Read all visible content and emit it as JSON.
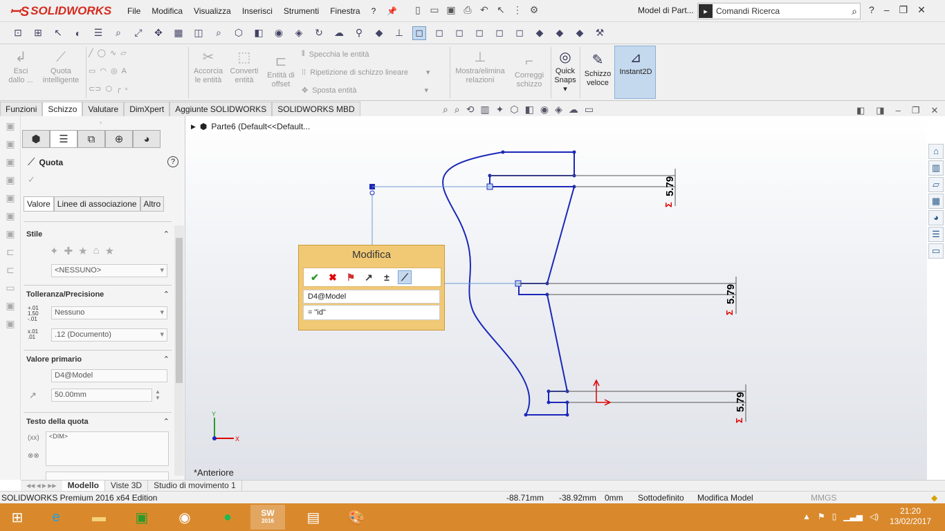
{
  "app": {
    "brand": "SOLIDWORKS",
    "document_title": "Model di Part...",
    "search_placeholder": "Comandi Ricerca"
  },
  "menu": [
    "File",
    "Modifica",
    "Visualizza",
    "Inserisci",
    "Strumenti",
    "Finestra",
    "?"
  ],
  "ribbon": {
    "exit_sketch": "Esci\ndallo ...",
    "smart_dim": "Quota\nintelligente",
    "trim": "Accorcia\nle entità",
    "convert": "Converti\nentità",
    "offset": "Entità di\noffset",
    "mirror": "Specchia le entità",
    "linear_pattern": "Ripetizione di schizzo lineare",
    "move": "Sposta entità",
    "relations": "Mostra/elimina\nrelazioni",
    "repair": "Correggi\nschizzo",
    "quick_snaps": "Quick\nSnaps",
    "rapid_sketch": "Schizzo\nveloce",
    "instant2d": "Instant2D"
  },
  "command_tabs": [
    "Funzioni",
    "Schizzo",
    "Valutare",
    "DimXpert",
    "Aggiunte SOLIDWORKS",
    "SOLIDWORKS MBD"
  ],
  "property_manager": {
    "title": "Quota",
    "subtabs": [
      "Valore",
      "Linee di associazione",
      "Altro"
    ],
    "style": {
      "header": "Stile",
      "value": "<NESSUNO>"
    },
    "tolerance": {
      "header": "Tolleranza/Precisione",
      "type": "Nessuno",
      "precision": ".12 (Documento)"
    },
    "primary": {
      "header": "Valore primario",
      "name": "D4@Model",
      "value": "50.00mm"
    },
    "dim_text": {
      "header": "Testo della quota",
      "value": "<DIM>"
    }
  },
  "viewport": {
    "tree_item": "Parte6  (Default<<Default...",
    "view_name": "*Anteriore",
    "dims": [
      "5.79",
      "5.79",
      "5.79"
    ],
    "axis_x": "X",
    "axis_y": "Y"
  },
  "modify_dialog": {
    "title": "Modifica",
    "dim_name": "D4@Model",
    "expression": "= \"id\""
  },
  "bottom_tabs": [
    "Modello",
    "Viste 3D",
    "Studio di movimento 1"
  ],
  "status": {
    "edition": "SOLIDWORKS Premium 2016 x64 Edition",
    "x": "-88.71mm",
    "y": "-38.92mm",
    "z": "0mm",
    "state": "Sottodefinito",
    "mode": "Modifica Model",
    "units": "MMGS"
  },
  "taskbar": {
    "time": "21:20",
    "date": "13/02/2017",
    "sw_badge": "2016"
  },
  "colors": {
    "sketch_blue": "#1a27b8",
    "dialog_bg": "#f1c975",
    "taskbar": "#d9892c",
    "accent_red": "#d52b1e"
  }
}
